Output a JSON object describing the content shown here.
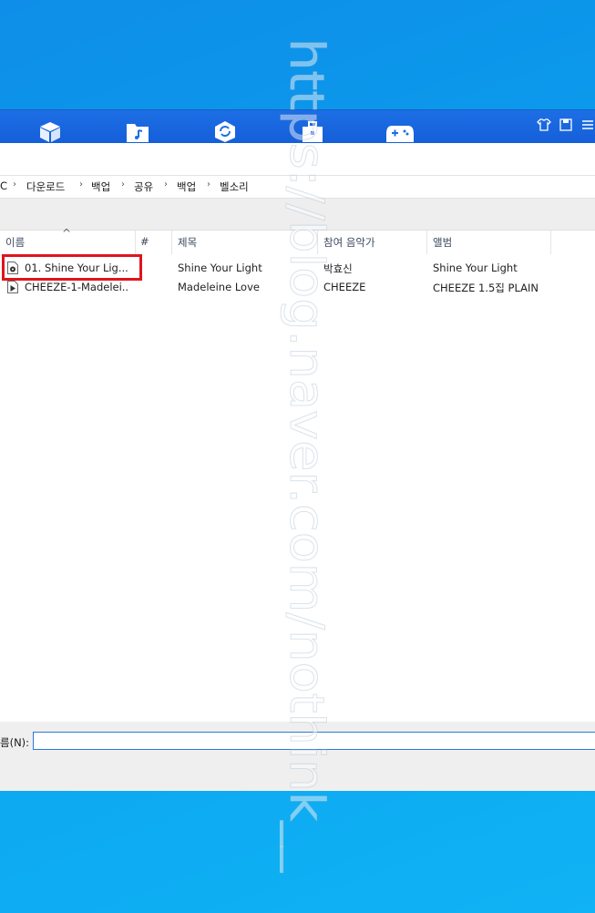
{
  "breadcrumb": [
    "C",
    "다운로드",
    "백업",
    "공유",
    "백업",
    "벨소리"
  ],
  "columns": {
    "name": "이름",
    "number": "#",
    "title": "제목",
    "artist": "참여 음악가",
    "album": "앨범"
  },
  "files": [
    {
      "name": "01. Shine Your Lig...",
      "title": "Shine Your Light",
      "artist": "박효신",
      "album": "Shine Your Light"
    },
    {
      "name": "CHEEZE-1-Madelei...",
      "title": "Madeleine Love",
      "artist": "CHEEZE",
      "album": "CHEEZE 1.5집 PLAIN"
    }
  ],
  "filename_label": "름(N):",
  "filename_value": "",
  "watermark": "https://blog.naver.com/nothink__"
}
